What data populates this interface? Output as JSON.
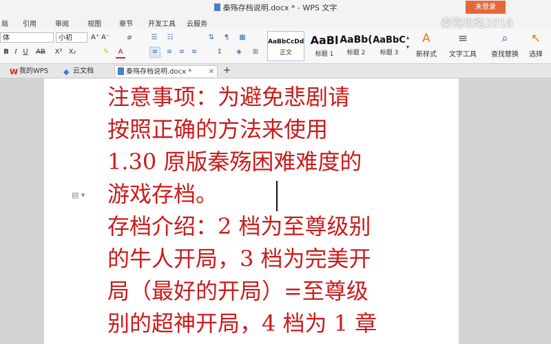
{
  "window": {
    "title": "秦殇存档说明.docx * - WPS 文字",
    "login_label": "未登录",
    "watermark": "秦殇攻略2018"
  },
  "ribbon": {
    "tabs": [
      "局",
      "引用",
      "审阅",
      "视图",
      "章节",
      "开发工具",
      "云服务"
    ]
  },
  "toolbar": {
    "font_name": "体",
    "font_size": "小初",
    "grow_font": "A⁺",
    "shrink_font": "A⁻",
    "format_painter": "⌀",
    "bold": "B",
    "italic": "I",
    "underline": "U",
    "strike": "AB",
    "superscript": "X²",
    "subscript": "X₂",
    "font_color": "A",
    "styles": [
      {
        "sample": "AaBbCcDd",
        "name": "正文"
      },
      {
        "sample": "AaBl",
        "name": "标题 1"
      },
      {
        "sample": "AaBb(",
        "name": "标题 2"
      },
      {
        "sample": "AaBbC",
        "name": "标题 3"
      }
    ],
    "new_style": "新样式",
    "text_tools": "文字工具",
    "find_replace": "查找替换",
    "select": "选择"
  },
  "tabbar": {
    "tabs": [
      "我的WPS",
      "云文档",
      "秦殇存档说明.docx *"
    ],
    "add": "+"
  },
  "document": {
    "lines": [
      "注意事项：为避免悲剧请",
      "按照正确的方法来使用",
      "1.30 原版秦殇困难难度的",
      "游戏存档。",
      "存档介绍：2 档为至尊级别",
      "的牛人开局，3 档为完美开",
      "局（最好的开局）=至尊级",
      "别的超神开局，4 档为 1 章"
    ]
  }
}
